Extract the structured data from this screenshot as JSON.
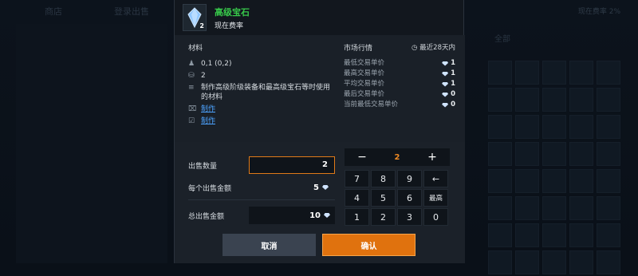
{
  "background": {
    "tab1": "商店",
    "tab2": "登录出售",
    "right_label": "现在费率 2%",
    "filter": "全部"
  },
  "item": {
    "name": "高级宝石",
    "subtitle": "现在费率",
    "quantity_badge": "2",
    "name_color": "#37c84a"
  },
  "materials": {
    "title": "材料",
    "rows": [
      {
        "icon": "bell-icon",
        "text": "0,1 (0,2)"
      },
      {
        "icon": "stack-icon",
        "text": "2"
      },
      {
        "icon": "list-icon",
        "text": "制作高级阶级装备和最高级宝石等时使用的材料"
      },
      {
        "icon": "craft-icon",
        "text": "制作"
      },
      {
        "icon": "clipboard-icon",
        "text": "制作"
      }
    ]
  },
  "market": {
    "title": "市场行情",
    "range": "最近28天内",
    "rows": [
      {
        "label": "最低交易单价",
        "value": "1"
      },
      {
        "label": "最高交易单价",
        "value": "1"
      },
      {
        "label": "平均交易单价",
        "value": "1"
      },
      {
        "label": "最后交易单价",
        "value": "0"
      },
      {
        "label": "当前最低交易单价",
        "value": "0"
      }
    ]
  },
  "sell": {
    "quantity_label": "出售数量",
    "quantity_value": "2",
    "unit_label": "每个出售金额",
    "unit_value": "5",
    "total_label": "总出售金额",
    "total_value": "10"
  },
  "keypad": {
    "minus": "−",
    "display": "2",
    "plus": "+",
    "keys": [
      "7",
      "8",
      "9",
      "←",
      "4",
      "5",
      "6",
      "最高",
      "1",
      "2",
      "3",
      "0"
    ]
  },
  "buttons": {
    "cancel": "取消",
    "confirm": "确认"
  },
  "colors": {
    "accent": "#e0720e",
    "link": "#4da3ff",
    "name_green": "#37c84a"
  }
}
